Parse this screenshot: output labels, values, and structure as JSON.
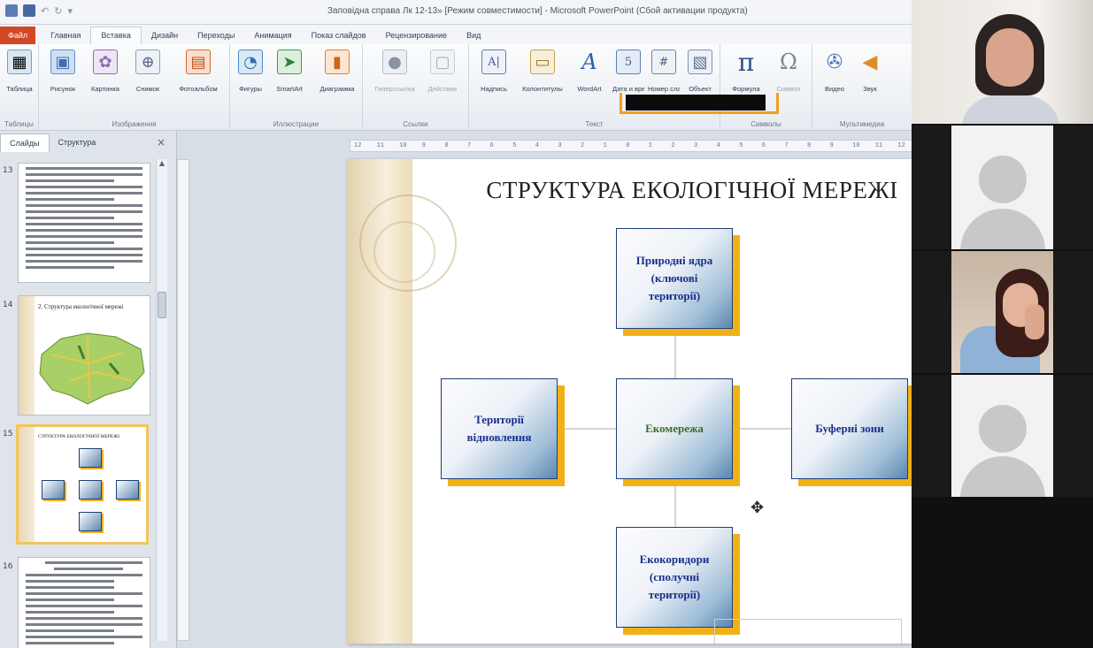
{
  "window": {
    "title": "Заповідна справа Лк 12-13» [Режим совместимости] - Microsoft PowerPoint (Сбой активации продукта)"
  },
  "ribbon_tabs": [
    "Файл",
    "Главная",
    "Вставка",
    "Дизайн",
    "Переходы",
    "Анимация",
    "Показ слайдов",
    "Рецензирование",
    "Вид"
  ],
  "ribbon_groups": {
    "tables": {
      "label": "Таблицы",
      "buttons": [
        {
          "label": "Таблица",
          "icon": "table-icon",
          "color": "#4f81bd"
        }
      ]
    },
    "images": {
      "label": "Изображения",
      "buttons": [
        {
          "label": "Рисунок",
          "icon": "picture-icon",
          "color": "#5b8fd0"
        },
        {
          "label": "Картинка",
          "icon": "clipart-icon",
          "color": "#8a6fb0"
        },
        {
          "label": "Снимок",
          "icon": "screenshot-icon",
          "color": "#8c9db5"
        },
        {
          "label": "Фотоальбом",
          "icon": "photo-album-icon",
          "color": "#d9682c"
        }
      ]
    },
    "illustrations": {
      "label": "Иллюстрации",
      "buttons": [
        {
          "label": "Фигуры",
          "icon": "shapes-icon",
          "color": "#4a8bc9"
        },
        {
          "label": "SmartArt",
          "icon": "smartart-icon",
          "color": "#3f9a4a"
        },
        {
          "label": "Диаграмма",
          "icon": "chart-icon",
          "color": "#e0822a"
        }
      ]
    },
    "links": {
      "label": "Ссылки",
      "buttons": [
        {
          "label": "Гиперссылка",
          "icon": "hyperlink-icon",
          "color": "#9aa3b1"
        },
        {
          "label": "Действие",
          "icon": "action-icon",
          "color": "#b7bfcb"
        }
      ]
    },
    "text": {
      "label": "Текст",
      "buttons": [
        {
          "label": "Надпись",
          "icon": "textbox-icon",
          "color": "#5d7fb0"
        },
        {
          "label": "Колонтитулы",
          "icon": "header-footer-icon",
          "color": "#c9a24a"
        },
        {
          "label": "WordArt",
          "icon": "wordart-icon",
          "color": "#2f5ea8"
        },
        {
          "label": "Дата и время",
          "icon": "datetime-icon",
          "color": "#5a7fae"
        },
        {
          "label": "Номер слайда",
          "icon": "slide-number-icon",
          "color": "#6c85a8"
        },
        {
          "label": "Объект",
          "icon": "object-icon",
          "color": "#7c93b3"
        }
      ]
    },
    "symbols": {
      "label": "Символы",
      "buttons": [
        {
          "label": "Формула",
          "icon": "pi-icon",
          "color": "#2d4f8c"
        },
        {
          "label": "Символ",
          "icon": "omega-icon",
          "color": "#7a8597"
        }
      ]
    },
    "media": {
      "label": "Мультимедиа",
      "buttons": [
        {
          "label": "Видео",
          "icon": "video-icon",
          "color": "#4d79b9"
        },
        {
          "label": "Звук",
          "icon": "sound-icon",
          "color": "#e08a2a"
        }
      ]
    }
  },
  "pane": {
    "tabs": [
      "Слайды",
      "Структура"
    ],
    "close": "×",
    "thumbnails": [
      {
        "number": "13",
        "title": ""
      },
      {
        "number": "14",
        "title": "2. Структура екологічної мережі"
      },
      {
        "number": "15",
        "title": "СТРУКТУРА ЕКОЛОГІЧНОЇ МЕРЕЖІ"
      },
      {
        "number": "16",
        "title": ""
      }
    ]
  },
  "slide": {
    "title": "СТРУКТУРА ЕКОЛОГІЧНОЇ МЕРЕЖІ",
    "nodes": {
      "top": "Природні ядра\n(ключові\nтериторії)",
      "left": "Території\nвідновлення",
      "center": "Екомережа",
      "right": "Буферні зони",
      "bottom": "Екокоридори\n(сполучні\nтериторії)"
    }
  },
  "ruler": {
    "ticks": [
      "12",
      "11",
      "10",
      "9",
      "8",
      "7",
      "6",
      "5",
      "4",
      "3",
      "2",
      "1",
      "0",
      "1",
      "2",
      "3",
      "4",
      "5",
      "6",
      "7",
      "8",
      "9",
      "10",
      "11",
      "12"
    ]
  },
  "colors": {
    "file_tab": "#d24726",
    "node_shadow": "#f2b017",
    "node_text": "#1a2f8c"
  }
}
